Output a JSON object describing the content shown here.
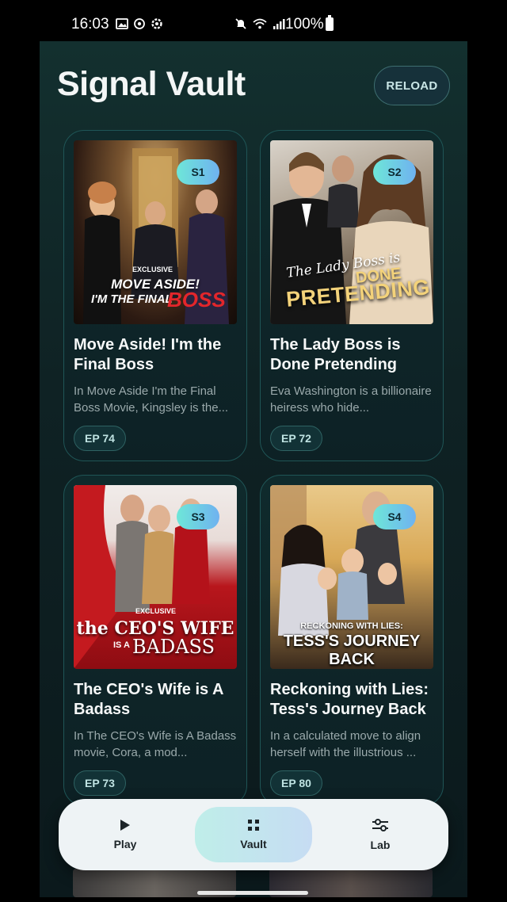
{
  "status": {
    "time": "16:03",
    "battery": "100%"
  },
  "app": {
    "title": "Signal Vault",
    "reload_label": "RELOAD"
  },
  "cards": [
    {
      "season": "S1",
      "title": "Move Aside! I'm the Final Boss",
      "description": "In Move Aside I'm the Final Boss Movie, Kingsley is the...",
      "episodes": "EP 74",
      "poster": {
        "badge": "EXCLUSIVE",
        "line1": "MOVE ASIDE!",
        "line2": "I'M THE FINAL",
        "line3": "BOSS"
      }
    },
    {
      "season": "S2",
      "title": "The Lady Boss is Done Pretending",
      "description": "Eva Washington is a billionaire heiress who hide...",
      "episodes": "EP 72",
      "poster": {
        "line1": "The Lady Boss is",
        "line2": "DONE",
        "line3": "PRETENDING"
      }
    },
    {
      "season": "S3",
      "title": "The CEO's Wife is A Badass",
      "description": "In The CEO's Wife is A Badass movie, Cora, a mod...",
      "episodes": "EP 73",
      "poster": {
        "badge": "EXCLUSIVE",
        "line1": "the CEO'S WIFE",
        "line2": "IS A",
        "line3": "BADASS"
      }
    },
    {
      "season": "S4",
      "title": "Reckoning with Lies: Tess's Journey Back",
      "description": "In a calculated move to align herself with the illustrious ...",
      "episodes": "EP 80",
      "poster": {
        "line1": "RECKONING WITH LIES:",
        "line2": "TESS'S JOURNEY BACK"
      }
    }
  ],
  "nav": [
    {
      "label": "Play",
      "icon": "play-icon"
    },
    {
      "label": "Vault",
      "icon": "grid-icon",
      "active": true
    },
    {
      "label": "Lab",
      "icon": "sliders-icon"
    }
  ],
  "colors": {
    "accent_gradient_start": "#6ee6d8",
    "accent_gradient_end": "#6fb2f0",
    "card_border": "#1f5556"
  }
}
